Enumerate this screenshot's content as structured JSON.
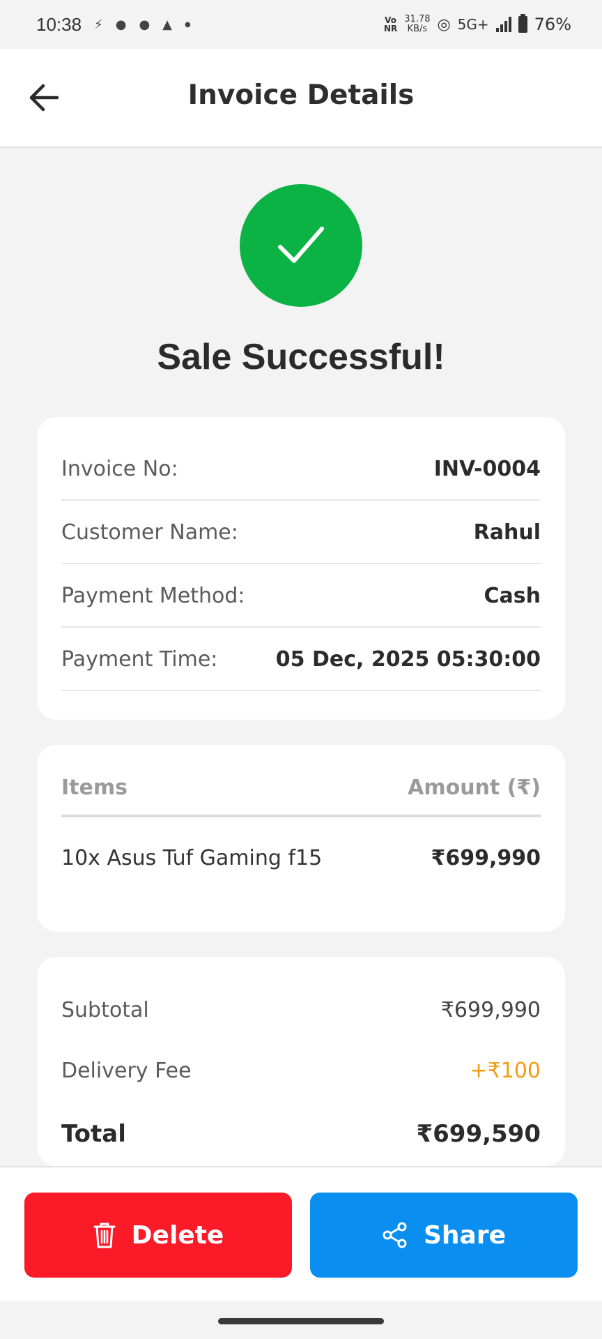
{
  "status_bar": {
    "time": "10:38",
    "net_speed_value": "31.78",
    "net_speed_unit": "KB/s",
    "volte_top": "Vo",
    "volte_bottom": "NR",
    "network": "5G+",
    "battery": "76%"
  },
  "header": {
    "title": "Invoice Details"
  },
  "success": {
    "title": "Sale Successful!",
    "color": "#0bb244"
  },
  "invoice": {
    "rows": [
      {
        "label": "Invoice No:",
        "value": "INV-0004"
      },
      {
        "label": "Customer Name:",
        "value": "Rahul"
      },
      {
        "label": "Payment Method:",
        "value": "Cash"
      },
      {
        "label": "Payment Time:",
        "value": "05 Dec, 2025 05:30:00"
      }
    ]
  },
  "items": {
    "header_items": "Items",
    "header_amount": "Amount (₹)",
    "rows": [
      {
        "name": "10x Asus Tuf Gaming f15",
        "amount": "₹699,990"
      }
    ]
  },
  "summary": {
    "subtotal_label": "Subtotal",
    "subtotal_value": "₹699,990",
    "delivery_label": "Delivery Fee",
    "delivery_value": "+₹100",
    "total_label": "Total",
    "total_value": "₹699,590"
  },
  "actions": {
    "delete_label": "Delete",
    "share_label": "Share",
    "delete_color": "#fb1a28",
    "share_color": "#0a8ff0"
  }
}
